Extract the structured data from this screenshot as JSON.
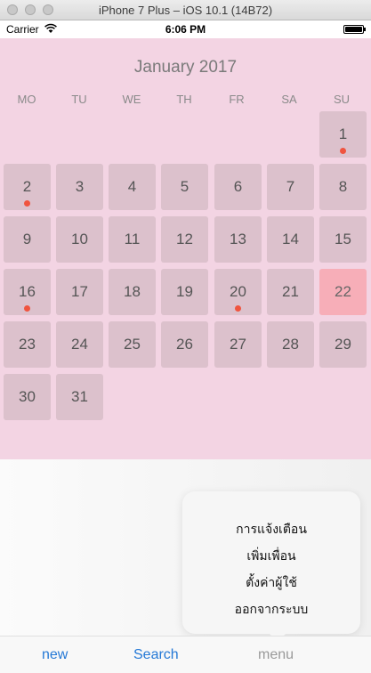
{
  "window": {
    "title": "iPhone 7 Plus – iOS 10.1 (14B72)"
  },
  "status_bar": {
    "carrier": "Carrier",
    "time": "6:06 PM"
  },
  "calendar": {
    "month_title": "January 2017",
    "weekdays": [
      "MO",
      "TU",
      "WE",
      "TH",
      "FR",
      "SA",
      "SU"
    ],
    "days": [
      "1",
      "2",
      "3",
      "4",
      "5",
      "6",
      "7",
      "8",
      "9",
      "10",
      "11",
      "12",
      "13",
      "14",
      "15",
      "16",
      "17",
      "18",
      "19",
      "20",
      "21",
      "22",
      "23",
      "24",
      "25",
      "26",
      "27",
      "28",
      "29",
      "30",
      "31"
    ],
    "event_days": [
      "1",
      "2",
      "16",
      "20"
    ],
    "selected_day": "22",
    "colors": {
      "background": "#f3d4e3",
      "day_cell": "#dcc1cc",
      "selected_cell": "#f7aeb8",
      "event_dot": "#f0543f"
    }
  },
  "menu": {
    "items": [
      "การแจ้งเตือน",
      "เพิ่มเพื่อน",
      "ตั้งค่าผู้ใช้",
      "ออกจากระบบ"
    ]
  },
  "tabbar": {
    "items": [
      "new",
      "Search",
      "menu"
    ],
    "active_color": "#2579d6"
  }
}
